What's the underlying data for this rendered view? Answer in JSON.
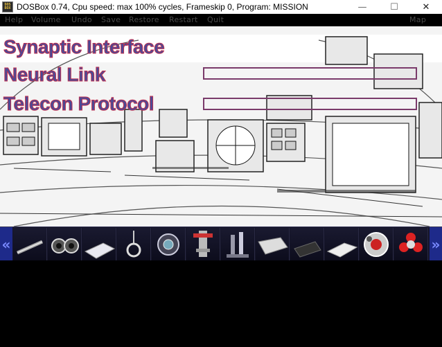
{
  "window": {
    "icon_text": [
      "DOS",
      "BOX"
    ],
    "title": "DOSBox 0.74, Cpu speed: max 100% cycles, Frameskip  0, Program:  MISSION",
    "minimize": "—",
    "maximize": "☐",
    "close": "✕"
  },
  "menu": {
    "items": [
      "Help",
      "Volume",
      "Undo",
      "Save",
      "Restore",
      "Restart",
      "Quit"
    ],
    "map": "Map"
  },
  "options": [
    {
      "label": "Synaptic Interface",
      "has_box": false
    },
    {
      "label": "Neural Link",
      "has_box": true
    },
    {
      "label": "Telecon Protocol",
      "has_box": true
    }
  ],
  "toolbar": {
    "left_arrow": "«",
    "right_arrow": "»",
    "items": [
      "wrench",
      "goggles",
      "notepad",
      "hook",
      "diving-helmet",
      "pipe-valve",
      "lever",
      "paper-scroll",
      "dark-panel",
      "slab",
      "red-orb-device",
      "red-flower-device"
    ]
  }
}
